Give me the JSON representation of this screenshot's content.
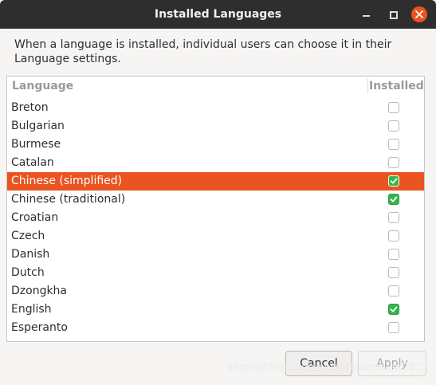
{
  "window": {
    "title": "Installed Languages",
    "controls": [
      "minimize-icon",
      "maximize-icon",
      "close-icon"
    ],
    "close_color": "#e95420"
  },
  "description": "When a language is installed, individual users can choose it in their Language settings.",
  "table": {
    "columns": [
      "Language",
      "Installed"
    ],
    "rows": [
      {
        "label": "Breton",
        "installed": false,
        "selected": false
      },
      {
        "label": "Bulgarian",
        "installed": false,
        "selected": false
      },
      {
        "label": "Burmese",
        "installed": false,
        "selected": false
      },
      {
        "label": "Catalan",
        "installed": false,
        "selected": false
      },
      {
        "label": "Chinese (simplified)",
        "installed": true,
        "selected": true
      },
      {
        "label": "Chinese (traditional)",
        "installed": true,
        "selected": false
      },
      {
        "label": "Croatian",
        "installed": false,
        "selected": false
      },
      {
        "label": "Czech",
        "installed": false,
        "selected": false
      },
      {
        "label": "Danish",
        "installed": false,
        "selected": false
      },
      {
        "label": "Dutch",
        "installed": false,
        "selected": false
      },
      {
        "label": "Dzongkha",
        "installed": false,
        "selected": false
      },
      {
        "label": "English",
        "installed": true,
        "selected": false
      },
      {
        "label": "Esperanto",
        "installed": false,
        "selected": false
      }
    ],
    "selection_color": "#e95420",
    "check_color": "#38b44a"
  },
  "buttons": {
    "cancel": "Cancel",
    "apply": "Apply"
  },
  "watermark": "https://blog.csdn.net/patternmian2017"
}
